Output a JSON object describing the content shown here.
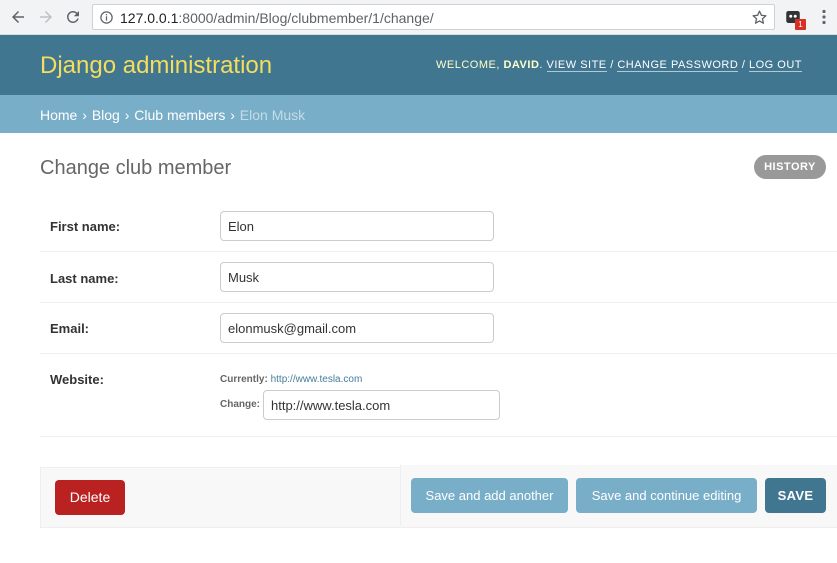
{
  "browser": {
    "url_host": "127.0.0.1",
    "url_rest": ":8000/admin/Blog/clubmember/1/change/",
    "extension_badge": "1"
  },
  "header": {
    "branding": "Django administration",
    "welcome": "Welcome, ",
    "username": "David",
    "view_site": "View site",
    "change_password": "Change password",
    "log_out": "Log out",
    "separator": " / "
  },
  "breadcrumbs": {
    "items": [
      "Home",
      "Blog",
      "Club members"
    ],
    "current": "Elon Musk",
    "sep": " › "
  },
  "content": {
    "title": "Change club member",
    "history": "History"
  },
  "form": {
    "first_name": {
      "label": "First name:",
      "value": "Elon"
    },
    "last_name": {
      "label": "Last name:",
      "value": "Musk"
    },
    "email": {
      "label": "Email:",
      "value": "elonmusk@gmail.com"
    },
    "website": {
      "label": "Website:",
      "currently_label": "Currently:",
      "currently_value": "http://www.tesla.com",
      "change_label": "Change:",
      "value": "http://www.tesla.com"
    }
  },
  "actions": {
    "delete": "Delete",
    "save_add_another": "Save and add another",
    "save_continue": "Save and continue editing",
    "save": "SAVE"
  },
  "colors": {
    "header": "#417690",
    "breadcrumbs": "#79aec8",
    "branding": "#f5dd5d",
    "delete": "#ba2121"
  }
}
